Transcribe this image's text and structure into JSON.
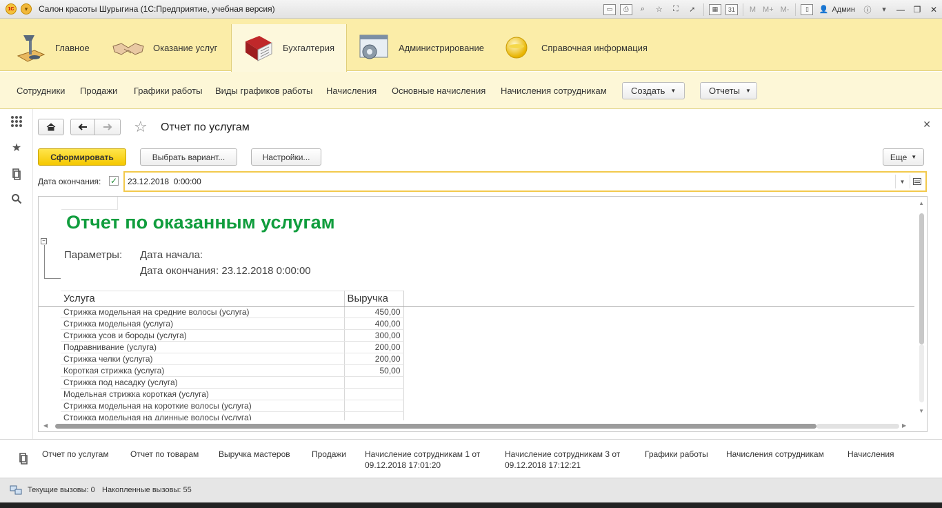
{
  "window": {
    "title": "Салон красоты Шурыгина  (1С:Предприятие, учебная версия)",
    "user": "Админ",
    "m_buttons": [
      "M",
      "M+",
      "M-"
    ]
  },
  "sections": [
    {
      "label": "Главное",
      "icon": "desk-lamp-icon"
    },
    {
      "label": "Оказание услуг",
      "icon": "handshake-icon"
    },
    {
      "label": "Бухгалтерия",
      "icon": "ledger-book-icon"
    },
    {
      "label": "Администрирование",
      "icon": "window-gear-icon"
    },
    {
      "label": "Справочная информация",
      "icon": "info-sphere-icon"
    }
  ],
  "nav": {
    "links": [
      "Сотрудники",
      "Продажи",
      "Графики работы",
      "Виды графиков работы",
      "Начисления",
      "Основные начисления",
      "Начисления сотрудникам"
    ],
    "create_label": "Создать",
    "reports_label": "Отчеты"
  },
  "form": {
    "title": "Отчет по услугам",
    "generate_label": "Сформировать",
    "variant_label": "Выбрать вариант...",
    "settings_label": "Настройки...",
    "more_label": "Еще",
    "end_date_label": "Дата окончания:",
    "end_date_value": "23.12.2018  0:00:00"
  },
  "report": {
    "title": "Отчет по оказанным услугам",
    "params_label": "Параметры:",
    "start_date_line": "Дата начала:",
    "end_date_line": "Дата окончания: 23.12.2018 0:00:00",
    "columns": [
      "Услуга",
      "Выручка"
    ],
    "rows": [
      {
        "service": "Стрижка модельная на средние волосы (услуга)",
        "revenue": "450,00"
      },
      {
        "service": "Стрижка модельная (услуга)",
        "revenue": "400,00"
      },
      {
        "service": "Стрижка усов и бороды (услуга)",
        "revenue": "300,00"
      },
      {
        "service": "Подравнивание (услуга)",
        "revenue": "200,00"
      },
      {
        "service": "Стрижка челки (услуга)",
        "revenue": "200,00"
      },
      {
        "service": "Короткая стрижка (услуга)",
        "revenue": "50,00"
      },
      {
        "service": "Стрижка под насадку (услуга)",
        "revenue": ""
      },
      {
        "service": "Модельная стрижка короткая (услуга)",
        "revenue": ""
      },
      {
        "service": "Стрижка модельная на короткие волосы (услуга)",
        "revenue": ""
      },
      {
        "service": "Стрижка модельная на длинные волосы (услуга)",
        "revenue": ""
      }
    ]
  },
  "windows": [
    "Отчет по услугам",
    "Отчет по товарам",
    "Выручка мастеров",
    "Продажи",
    "Начисление сотрудникам 1 от 09.12.2018 17:01:20",
    "Начисление сотрудникам 3 от 09.12.2018 17:12:21",
    "Графики работы",
    "Начисления сотрудникам",
    "Начисления"
  ],
  "status": {
    "current_calls": "Текущие вызовы: 0",
    "accumulated_calls": "Накопленные вызовы: 55"
  },
  "colors": {
    "sections_bg": "#fbeda8",
    "report_title": "#109d3d",
    "primary_button": "#f5c800"
  }
}
